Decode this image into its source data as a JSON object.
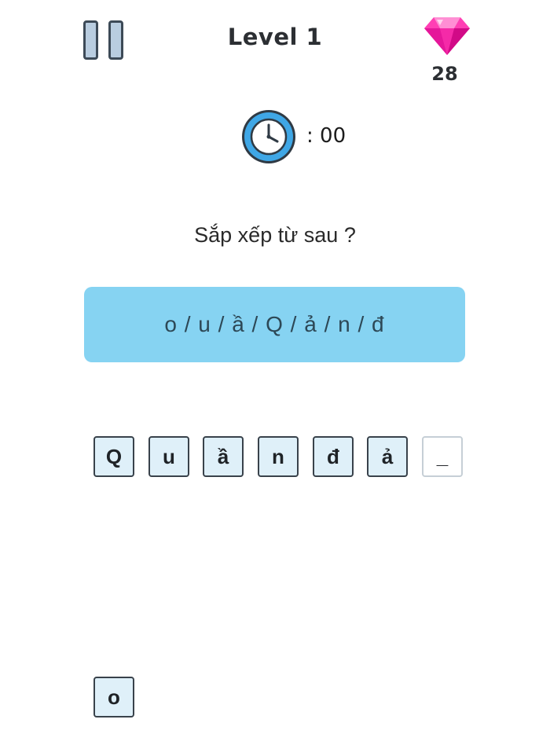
{
  "header": {
    "level_title": "Level 1",
    "gem_count": "28",
    "gem_color": "#ff3fb4",
    "pause_icon": "pause-icon"
  },
  "timer": {
    "icon": "clock-icon",
    "text": ": 00"
  },
  "question": {
    "prompt": "Sắp xếp từ sau ?",
    "scrambled": "o / u / ầ / Q / ả / n / đ"
  },
  "answer": {
    "slots": [
      "Q",
      "u",
      "ầ",
      "n",
      "đ",
      "ả",
      "_"
    ]
  },
  "bank": {
    "letters": [
      "o"
    ]
  },
  "colors": {
    "scramble_bg": "#86d3f2",
    "tile_bg": "#dff0f9"
  }
}
